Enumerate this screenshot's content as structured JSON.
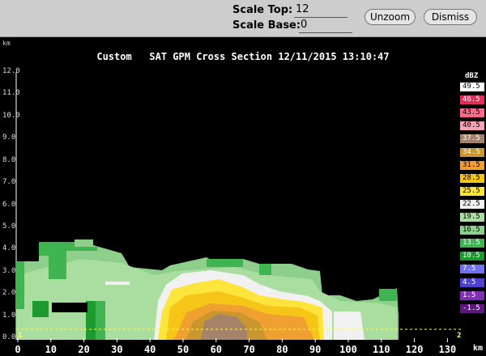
{
  "controls": {
    "scale_top_label": "Scale Top:",
    "scale_top_value": "12",
    "scale_base_label": "Scale Base:",
    "scale_base_value": "0",
    "unzoom_label": "Unzoom",
    "dismiss_label": "Dismiss"
  },
  "plot": {
    "title": "Custom   SAT GPM Cross Section 12/11/2015 13:10:47",
    "y_unit": "km",
    "x_unit": "km",
    "y_ticks": [
      "0.0",
      "1.0",
      "2.0",
      "3.0",
      "4.0",
      "5.0",
      "6.0",
      "7.0",
      "8.0",
      "9.0",
      "10.0",
      "11.0",
      "12.0"
    ],
    "x_ticks": [
      "0",
      "10",
      "20",
      "30",
      "40",
      "50",
      "60",
      "70",
      "80",
      "90",
      "100",
      "110",
      "120",
      "130"
    ],
    "endpoint_start": "1",
    "endpoint_end": "2",
    "colors": {
      "background": "#000000",
      "ui_bar": "#cdcdcd",
      "endpoint_line": "#ffff44"
    }
  },
  "legend": {
    "unit": "dBZ",
    "entries": [
      {
        "label": "49.5",
        "color": "#ffffff"
      },
      {
        "label": "46.5",
        "color": "#e0305a"
      },
      {
        "label": "43.5",
        "color": "#ff6a88"
      },
      {
        "label": "40.5",
        "color": "#f8a2b5"
      },
      {
        "label": "37.5",
        "color": "#a5836b"
      },
      {
        "label": "34.5",
        "color": "#c9962f"
      },
      {
        "label": "31.5",
        "color": "#f0a030"
      },
      {
        "label": "28.5",
        "color": "#f5c518"
      },
      {
        "label": "25.5",
        "color": "#ffe53b"
      },
      {
        "label": "22.5",
        "color": "#f1f1f1"
      },
      {
        "label": "19.5",
        "color": "#a9dea0"
      },
      {
        "label": "16.5",
        "color": "#8ed08b"
      },
      {
        "label": "13.5",
        "color": "#40b450"
      },
      {
        "label": "10.5",
        "color": "#1c9a2e"
      },
      {
        "label": "7.5",
        "color": "#7070f0"
      },
      {
        "label": "4.5",
        "color": "#5040d0"
      },
      {
        "label": "1.5",
        "color": "#8030b0"
      },
      {
        "label": "-1.5",
        "color": "#601880"
      }
    ]
  },
  "chart_data": {
    "type": "heatmap",
    "title": "Custom   SAT GPM Cross Section 12/11/2015 13:10:47",
    "xlabel": "km",
    "ylabel": "km",
    "xlim": [
      0,
      133
    ],
    "ylim": [
      0,
      12
    ],
    "colorbar_label": "dBZ"
  }
}
